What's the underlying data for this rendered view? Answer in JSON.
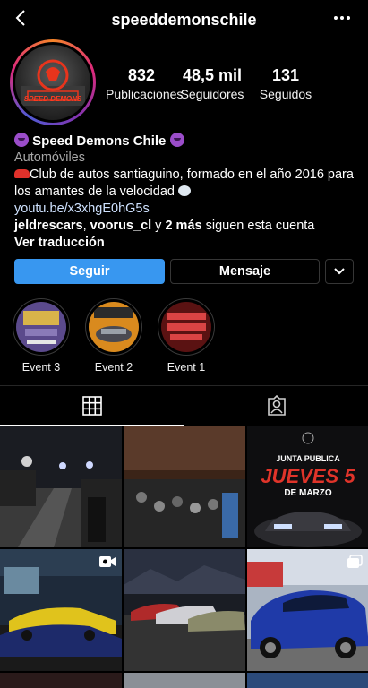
{
  "header": {
    "username": "speeddemonschile"
  },
  "avatar": {
    "text": "SPEED DEMONS"
  },
  "stats": {
    "posts": {
      "value": "832",
      "label": "Publicaciones"
    },
    "followers": {
      "value": "48,5 mil",
      "label": "Seguidores"
    },
    "following": {
      "value": "131",
      "label": "Seguidos"
    }
  },
  "bio": {
    "name": "Speed Demons Chile",
    "category": "Automóviles",
    "description_line1": "Club de autos santiaguino, formado en el año 2016 para",
    "description_line2": "los amantes de la velocidad",
    "link": "youtu.be/x3xhgE0hG5s",
    "followed_by_1": "jeldrescars",
    "followed_by_2": "voorus_cl",
    "followed_by_sep": " y ",
    "followed_by_more": "2 más",
    "followed_by_suffix": " siguen esta cuenta",
    "translate": "Ver traducción"
  },
  "actions": {
    "follow": "Seguir",
    "message": "Mensaje"
  },
  "highlights": [
    {
      "label": "Event 3"
    },
    {
      "label": "Event 2"
    },
    {
      "label": "Event 1"
    }
  ],
  "posts": [
    {
      "text": ""
    },
    {
      "text": ""
    },
    {
      "text": "JUNTA PUBLICA",
      "headline": "JUEVES 5",
      "sub": "DE MARZO"
    }
  ],
  "colors": {
    "follow_button": "#3897f0",
    "background": "#000000",
    "border": "#363636",
    "secondary_text": "#a8a8a8"
  }
}
